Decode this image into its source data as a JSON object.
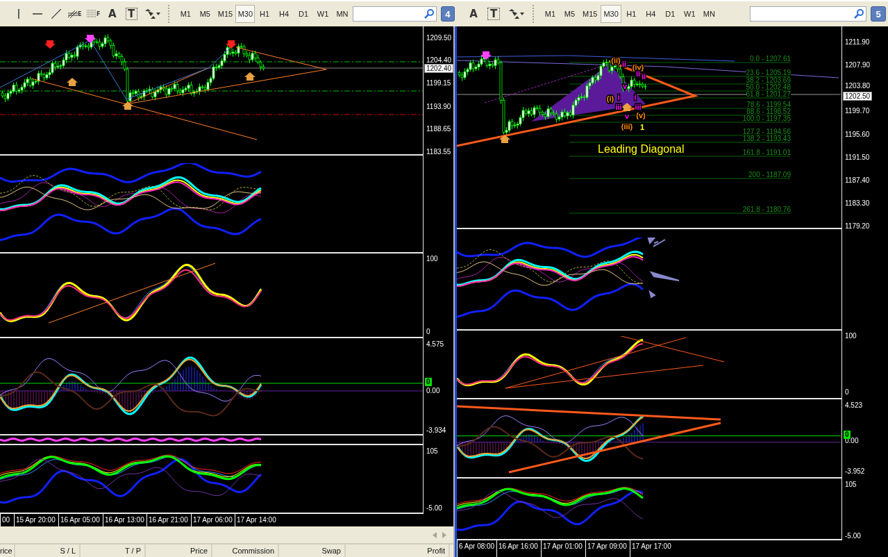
{
  "toolbars": [
    {
      "tools": [
        {
          "kind": "vline"
        },
        {
          "kind": "hline"
        },
        {
          "kind": "trendline"
        },
        {
          "kind": "fan",
          "glyph": "E"
        },
        {
          "kind": "grid",
          "glyph": "F"
        },
        {
          "kind": "text",
          "glyph": "A"
        },
        {
          "kind": "label",
          "glyph": "T"
        },
        {
          "kind": "arrows"
        }
      ],
      "timeframes": [
        {
          "label": "M1",
          "selected": false
        },
        {
          "label": "M5",
          "selected": false
        },
        {
          "label": "M15",
          "selected": false
        },
        {
          "label": "M30",
          "selected": true
        },
        {
          "label": "H1",
          "selected": false
        },
        {
          "label": "H4",
          "selected": false
        },
        {
          "label": "D1",
          "selected": false
        },
        {
          "label": "W1",
          "selected": false
        },
        {
          "label": "MN",
          "selected": false
        }
      ],
      "badge": "4"
    },
    {
      "tools": [
        {
          "kind": "text",
          "glyph": "A"
        },
        {
          "kind": "label",
          "glyph": "T"
        },
        {
          "kind": "arrows"
        }
      ],
      "timeframes": [
        {
          "label": "M1",
          "selected": false
        },
        {
          "label": "M5",
          "selected": false
        },
        {
          "label": "M15",
          "selected": false
        },
        {
          "label": "M30",
          "selected": true
        },
        {
          "label": "H1",
          "selected": false
        },
        {
          "label": "H4",
          "selected": false
        },
        {
          "label": "D1",
          "selected": false
        },
        {
          "label": "W1",
          "selected": false
        },
        {
          "label": "MN",
          "selected": false
        }
      ],
      "badge": "5"
    }
  ],
  "left_chart": {
    "price_axis": [
      "1209.50",
      "1204.40",
      "1199.15",
      "1193.90",
      "1188.65",
      "1183.55"
    ],
    "current_price": "1202.40",
    "panes": [
      {
        "kind": "bands"
      },
      {
        "kind": "stoch",
        "labels": [
          "100",
          "0"
        ]
      },
      {
        "kind": "macd",
        "labels": [
          "4.575",
          "0.00",
          "-3.934"
        ],
        "marker": "0"
      },
      {
        "kind": "thin"
      },
      {
        "kind": "rsi",
        "labels": [
          "105",
          "-5.00"
        ]
      }
    ],
    "time_axis": [
      "00",
      "15 Apr 20:00",
      "16 Apr 05:00",
      "16 Apr 13:00",
      "16 Apr 21:00",
      "17 Apr 06:00",
      "17 Apr 14:00"
    ]
  },
  "right_chart": {
    "price_axis": [
      "1211.90",
      "1207.90",
      "1203.80",
      "1199.70",
      "1195.60",
      "1191.50",
      "1187.40",
      "1183.30",
      "1179.20"
    ],
    "current_price": "1202.50",
    "fib_levels": [
      "0.0 - 1207.61",
      "23.6 - 1205.19",
      "38.2 - 1203.69",
      "50.0 - 1202.48",
      "61.8 - 1201.27",
      "78.6 - 1199.54",
      "88.6 - 1198.52",
      "100.0 - 1197.35",
      "127.2 - 1194.56",
      "138.2 - 1193.43",
      "161.8 - 1191.01",
      "200 - 1187.09",
      "261.8 - 1180.76"
    ],
    "annotation": "Leading Diagonal",
    "wave_labels": [
      {
        "text": "(ii)",
        "kind": "intermediate"
      },
      {
        "text": "ii",
        "kind": "minor"
      },
      {
        "text": "(iv)",
        "kind": "intermediate"
      },
      {
        "text": "ii",
        "kind": "minor"
      },
      {
        "text": "ii",
        "kind": "minor"
      },
      {
        "text": "v",
        "kind": "minor"
      },
      {
        "text": "(i)",
        "kind": "intermediate"
      },
      {
        "text": "i",
        "kind": "minor"
      },
      {
        "text": "i",
        "kind": "minor"
      },
      {
        "text": "iii",
        "kind": "minor"
      },
      {
        "text": "iii",
        "kind": "minor"
      },
      {
        "text": "v",
        "kind": "minor"
      },
      {
        "text": "(v)",
        "kind": "intermediate"
      },
      {
        "text": "(iii)",
        "kind": "intermediate"
      },
      {
        "text": "1",
        "kind": "primary"
      }
    ],
    "panes": [
      {
        "kind": "bands"
      },
      {
        "kind": "stoch",
        "labels": [
          "100",
          "0"
        ]
      },
      {
        "kind": "macd",
        "labels": [
          "4.523",
          "0.00",
          "-3.952"
        ],
        "marker": "0"
      },
      {
        "kind": "rsi",
        "labels": [
          "105",
          "-5.00"
        ]
      }
    ],
    "time_axis": [
      "6 Apr 08:00",
      "16 Apr 16:00",
      "17 Apr 01:00",
      "17 Apr 09:00",
      "17 Apr 17:00"
    ]
  },
  "terminal": {
    "columns": [
      "rice",
      "S / L",
      "T / P",
      "Price",
      "Commission",
      "Swap",
      "Profit"
    ]
  }
}
